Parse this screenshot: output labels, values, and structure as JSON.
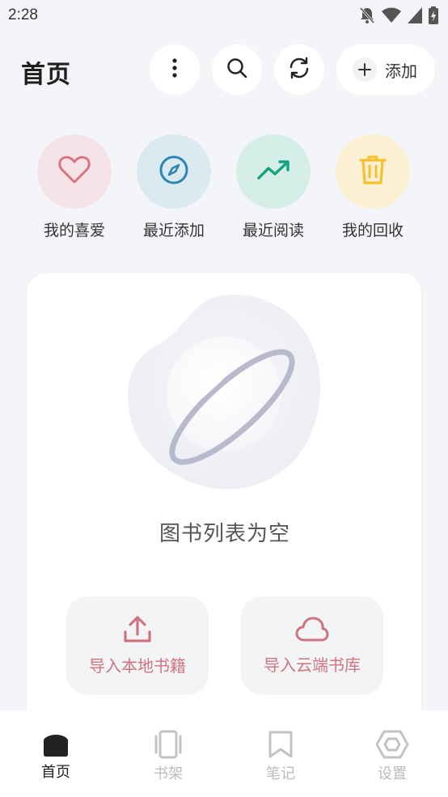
{
  "status": {
    "time": "2:28"
  },
  "header": {
    "title": "首页",
    "add_label": "添加"
  },
  "quick": [
    {
      "label": "我的喜爱",
      "icon": "heart-icon",
      "bg": "#f5e3e8",
      "color": "#dc7582"
    },
    {
      "label": "最近添加",
      "icon": "compass-icon",
      "bg": "#dbe9f1",
      "color": "#2b86b5"
    },
    {
      "label": "最近阅读",
      "icon": "trending-up-icon",
      "bg": "#d5efe8",
      "color": "#14a37f"
    },
    {
      "label": "我的回收",
      "icon": "trash-icon",
      "bg": "#fbf0d3",
      "color": "#f5c02b"
    }
  ],
  "empty": {
    "message": "图书列表为空",
    "import_local": "导入本地书籍",
    "import_cloud": "导入云端书库"
  },
  "nav": [
    {
      "label": "首页",
      "icon": "home-icon",
      "active": true
    },
    {
      "label": "书架",
      "icon": "bookshelf-icon",
      "active": false
    },
    {
      "label": "笔记",
      "icon": "bookmark-icon",
      "active": false
    },
    {
      "label": "设置",
      "icon": "settings-hexagon-icon",
      "active": false
    }
  ]
}
